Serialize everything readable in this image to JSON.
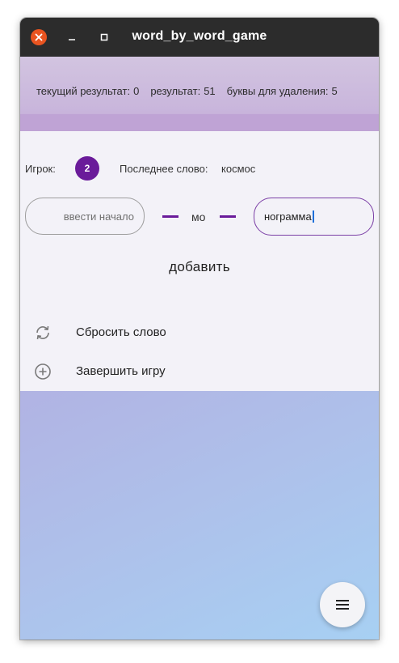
{
  "window": {
    "title": "word_by_word_game"
  },
  "score_bar": {
    "current_result_label": "текущий результат:",
    "current_result_value": "0",
    "result_label": "результат:",
    "result_value": "51",
    "letters_to_remove_label": "буквы для удаления:",
    "letters_to_remove_value": "5"
  },
  "player": {
    "label": "Игрок:",
    "number": "2"
  },
  "last_word": {
    "label": "Последнее слово:",
    "value": "космос"
  },
  "word_input": {
    "prefix_placeholder": "ввести начало",
    "middle": "мо",
    "suffix_value": "нограмма"
  },
  "actions": {
    "add_label": "добавить"
  },
  "menu": {
    "reset_label": "Сбросить слово",
    "finish_label": "Завершить игру"
  },
  "colors": {
    "accent": "#6a1b9a",
    "titlebar": "#2c2c2c",
    "close": "#e95420"
  },
  "icons": {
    "reset": "refresh-icon",
    "finish": "add-circle-icon",
    "fab": "menu-icon"
  }
}
